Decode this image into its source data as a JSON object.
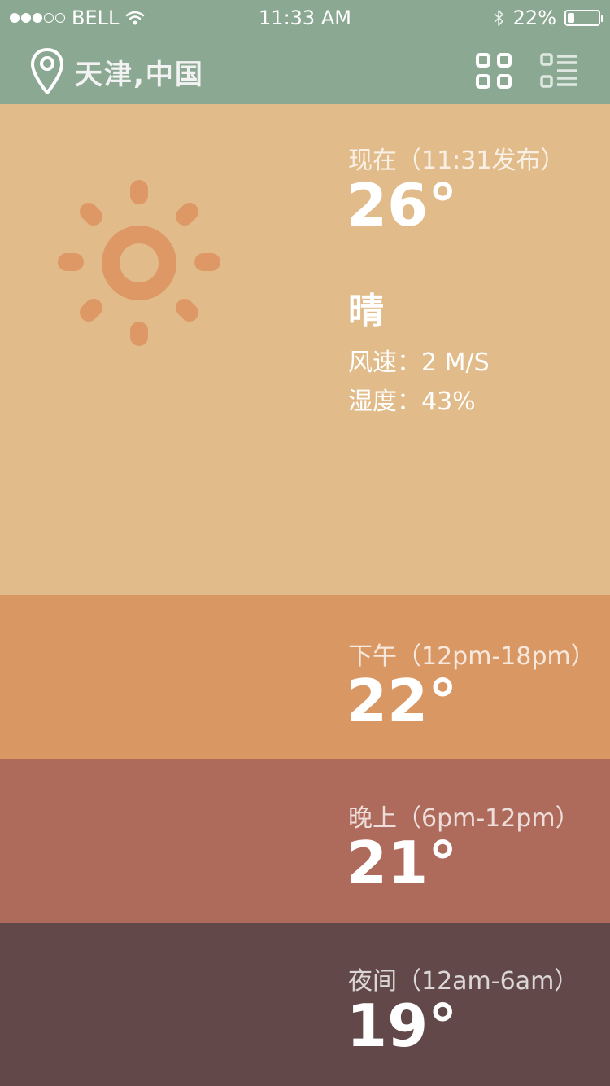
{
  "status_bar": {
    "carrier": "BELL",
    "time": "11:33 AM",
    "battery": "22%",
    "battery_level": 0.22
  },
  "header": {
    "location": "天津,中国"
  },
  "current": {
    "label": "现在（11:31发布）",
    "temp": "26°",
    "condition": "晴",
    "wind": "风速：2 M/S",
    "humidity": "湿度：43%"
  },
  "periods": [
    {
      "label": "下午（12pm-18pm）",
      "temp": "22°"
    },
    {
      "label": "晚上（6pm-12pm）",
      "temp": "21°"
    },
    {
      "label": "夜间（12am-6am）",
      "temp": "19°"
    }
  ],
  "colors": {
    "header": "#8ba892",
    "current": "#e1bb89",
    "afternoon": "#d99764",
    "evening": "#ae6a5a",
    "night": "#624849",
    "sun_icon": "#dd9866"
  },
  "icons": [
    "location-pin-icon",
    "grid-view-icon",
    "list-view-icon",
    "wifi-icon",
    "bluetooth-icon",
    "battery-icon",
    "sun-icon"
  ]
}
